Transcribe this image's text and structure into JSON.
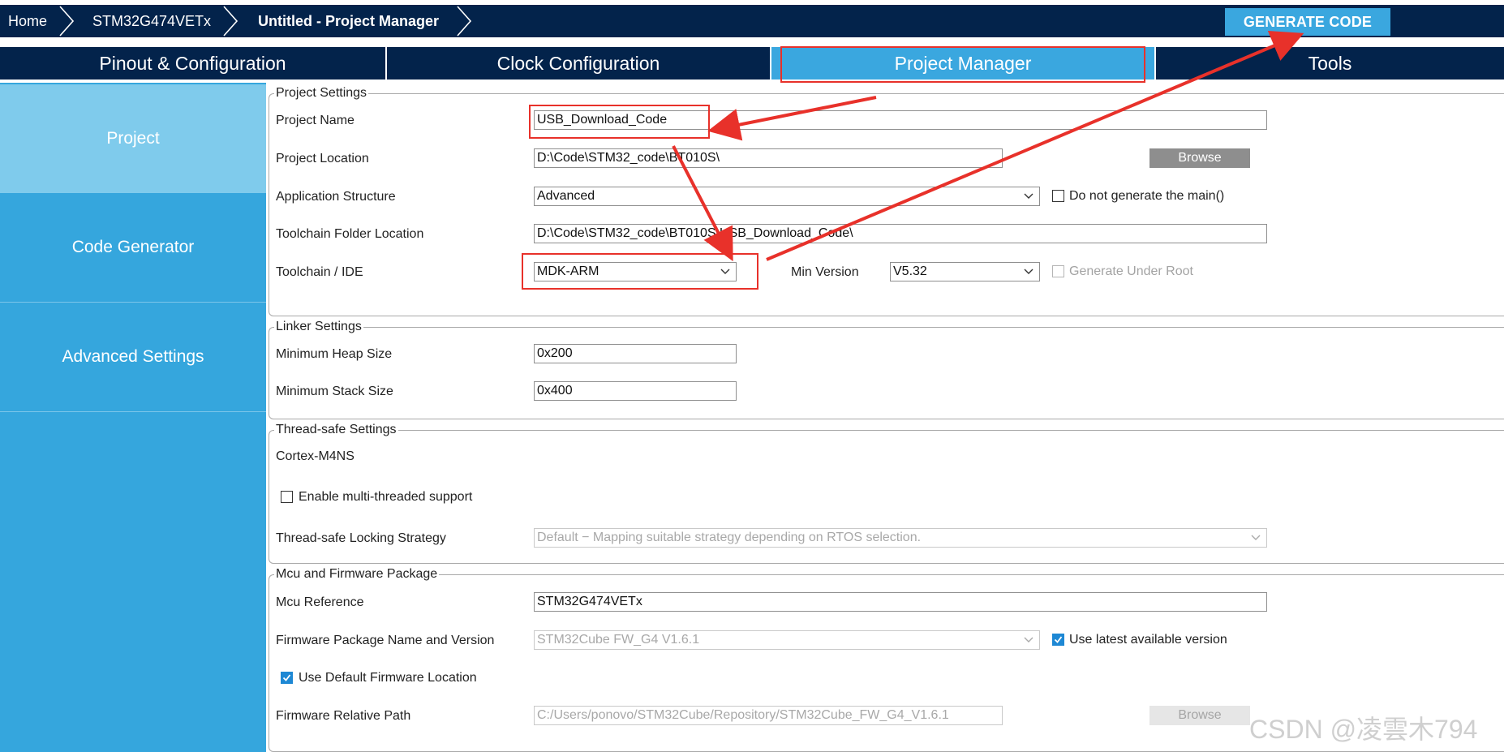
{
  "breadcrumb": {
    "items": [
      "Home",
      "STM32G474VETx",
      "Untitled - Project Manager"
    ]
  },
  "generate_button": "GENERATE CODE",
  "tabs": [
    "Pinout & Configuration",
    "Clock Configuration",
    "Project Manager",
    "Tools"
  ],
  "sidebar": {
    "items": [
      "Project",
      "Code Generator",
      "Advanced Settings"
    ]
  },
  "project_settings": {
    "legend": "Project Settings",
    "project_name_label": "Project Name",
    "project_name_value": "USB_Download_Code",
    "project_location_label": "Project Location",
    "project_location_value": "D:\\Code\\STM32_code\\BT010S\\",
    "browse_label": "Browse",
    "app_structure_label": "Application Structure",
    "app_structure_value": "Advanced",
    "no_main_label": "Do not generate the main()",
    "toolchain_folder_label": "Toolchain Folder Location",
    "toolchain_folder_value": "D:\\Code\\STM32_code\\BT010S\\USB_Download_Code\\",
    "toolchain_ide_label": "Toolchain / IDE",
    "toolchain_ide_value": "MDK-ARM",
    "min_version_label": "Min Version",
    "min_version_value": "V5.32",
    "generate_under_root_label": "Generate Under Root"
  },
  "linker_settings": {
    "legend": "Linker Settings",
    "heap_label": "Minimum Heap Size",
    "heap_value": "0x200",
    "stack_label": "Minimum Stack Size",
    "stack_value": "0x400"
  },
  "thread_safe": {
    "legend": "Thread-safe Settings",
    "core_label": "Cortex-M4NS",
    "multi_thread_label": "Enable multi-threaded support",
    "locking_label": "Thread-safe Locking Strategy",
    "locking_value": "Default  −  Mapping suitable strategy depending on RTOS selection."
  },
  "mcu_firmware": {
    "legend": "Mcu and Firmware Package",
    "mcu_ref_label": "Mcu Reference",
    "mcu_ref_value": "STM32G474VETx",
    "fw_name_label": "Firmware Package Name and Version",
    "fw_name_value": "STM32Cube FW_G4 V1.6.1",
    "use_latest_label": "Use latest available version",
    "use_default_loc_label": "Use Default Firmware Location",
    "fw_path_label": "Firmware Relative Path",
    "fw_path_value": "C:/Users/ponovo/STM32Cube/Repository/STM32Cube_FW_G4_V1.6.1",
    "browse_label": "Browse"
  },
  "watermark": "CSDN @凌雲木794",
  "colors": {
    "navy": "#03234b",
    "accent": "#3aa7df",
    "sidebar": "#35a6dd",
    "sidebar_active": "#7fcbec",
    "annotation_red": "#e8312a"
  }
}
